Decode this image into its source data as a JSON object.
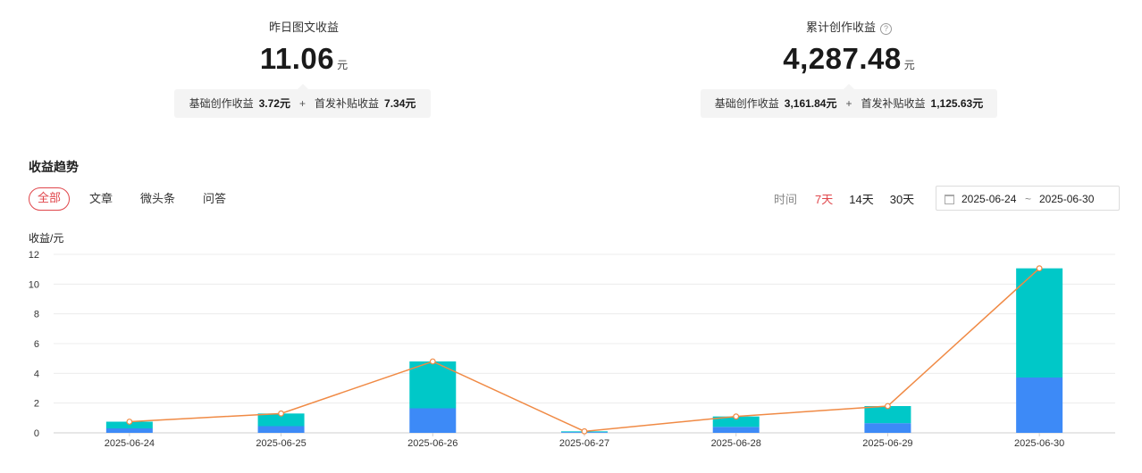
{
  "summary": {
    "yesterday": {
      "title": "昨日图文收益",
      "value": "11.06",
      "unit": "元",
      "base_label": "基础创作收益",
      "base_value": "3.72元",
      "plus": "+",
      "bonus_label": "首发补贴收益",
      "bonus_value": "7.34元"
    },
    "total": {
      "title": "累计创作收益",
      "help_icon": "?",
      "value": "4,287.48",
      "unit": "元",
      "base_label": "基础创作收益",
      "base_value": "3,161.84元",
      "plus": "+",
      "bonus_label": "首发补贴收益",
      "bonus_value": "1,125.63元"
    }
  },
  "trend": {
    "title": "收益趋势",
    "tabs": [
      {
        "label": "全部",
        "active": true
      },
      {
        "label": "文章",
        "active": false
      },
      {
        "label": "微头条",
        "active": false
      },
      {
        "label": "问答",
        "active": false
      }
    ],
    "time_label": "时间",
    "periods": [
      {
        "label": "7天",
        "active": true
      },
      {
        "label": "14天",
        "active": false
      },
      {
        "label": "30天",
        "active": false
      }
    ],
    "date_start": "2025-06-24",
    "date_sep": "~",
    "date_end": "2025-06-30"
  },
  "colors": {
    "accent": "#e0464b",
    "bar_base": "#3d8af7",
    "bar_bonus": "#00c8c8",
    "line": "#f08a45"
  },
  "chart_data": {
    "type": "bar",
    "ylabel": "收益/元",
    "ylim": [
      0,
      12
    ],
    "yticks": [
      0,
      2,
      4,
      6,
      8,
      10,
      12
    ],
    "grid": true,
    "categories": [
      "2025-06-24",
      "2025-06-25",
      "2025-06-26",
      "2025-06-27",
      "2025-06-28",
      "2025-06-29",
      "2025-06-30"
    ],
    "series": [
      {
        "type": "bar",
        "stack": "total",
        "values": [
          0.3,
          0.45,
          1.65,
          0.05,
          0.4,
          0.65,
          3.72
        ]
      },
      {
        "type": "bar",
        "stack": "total",
        "values": [
          0.45,
          0.85,
          3.15,
          0.05,
          0.7,
          1.15,
          7.34
        ]
      },
      {
        "type": "line",
        "values": [
          0.75,
          1.3,
          4.8,
          0.1,
          1.1,
          1.8,
          11.06
        ]
      }
    ]
  }
}
